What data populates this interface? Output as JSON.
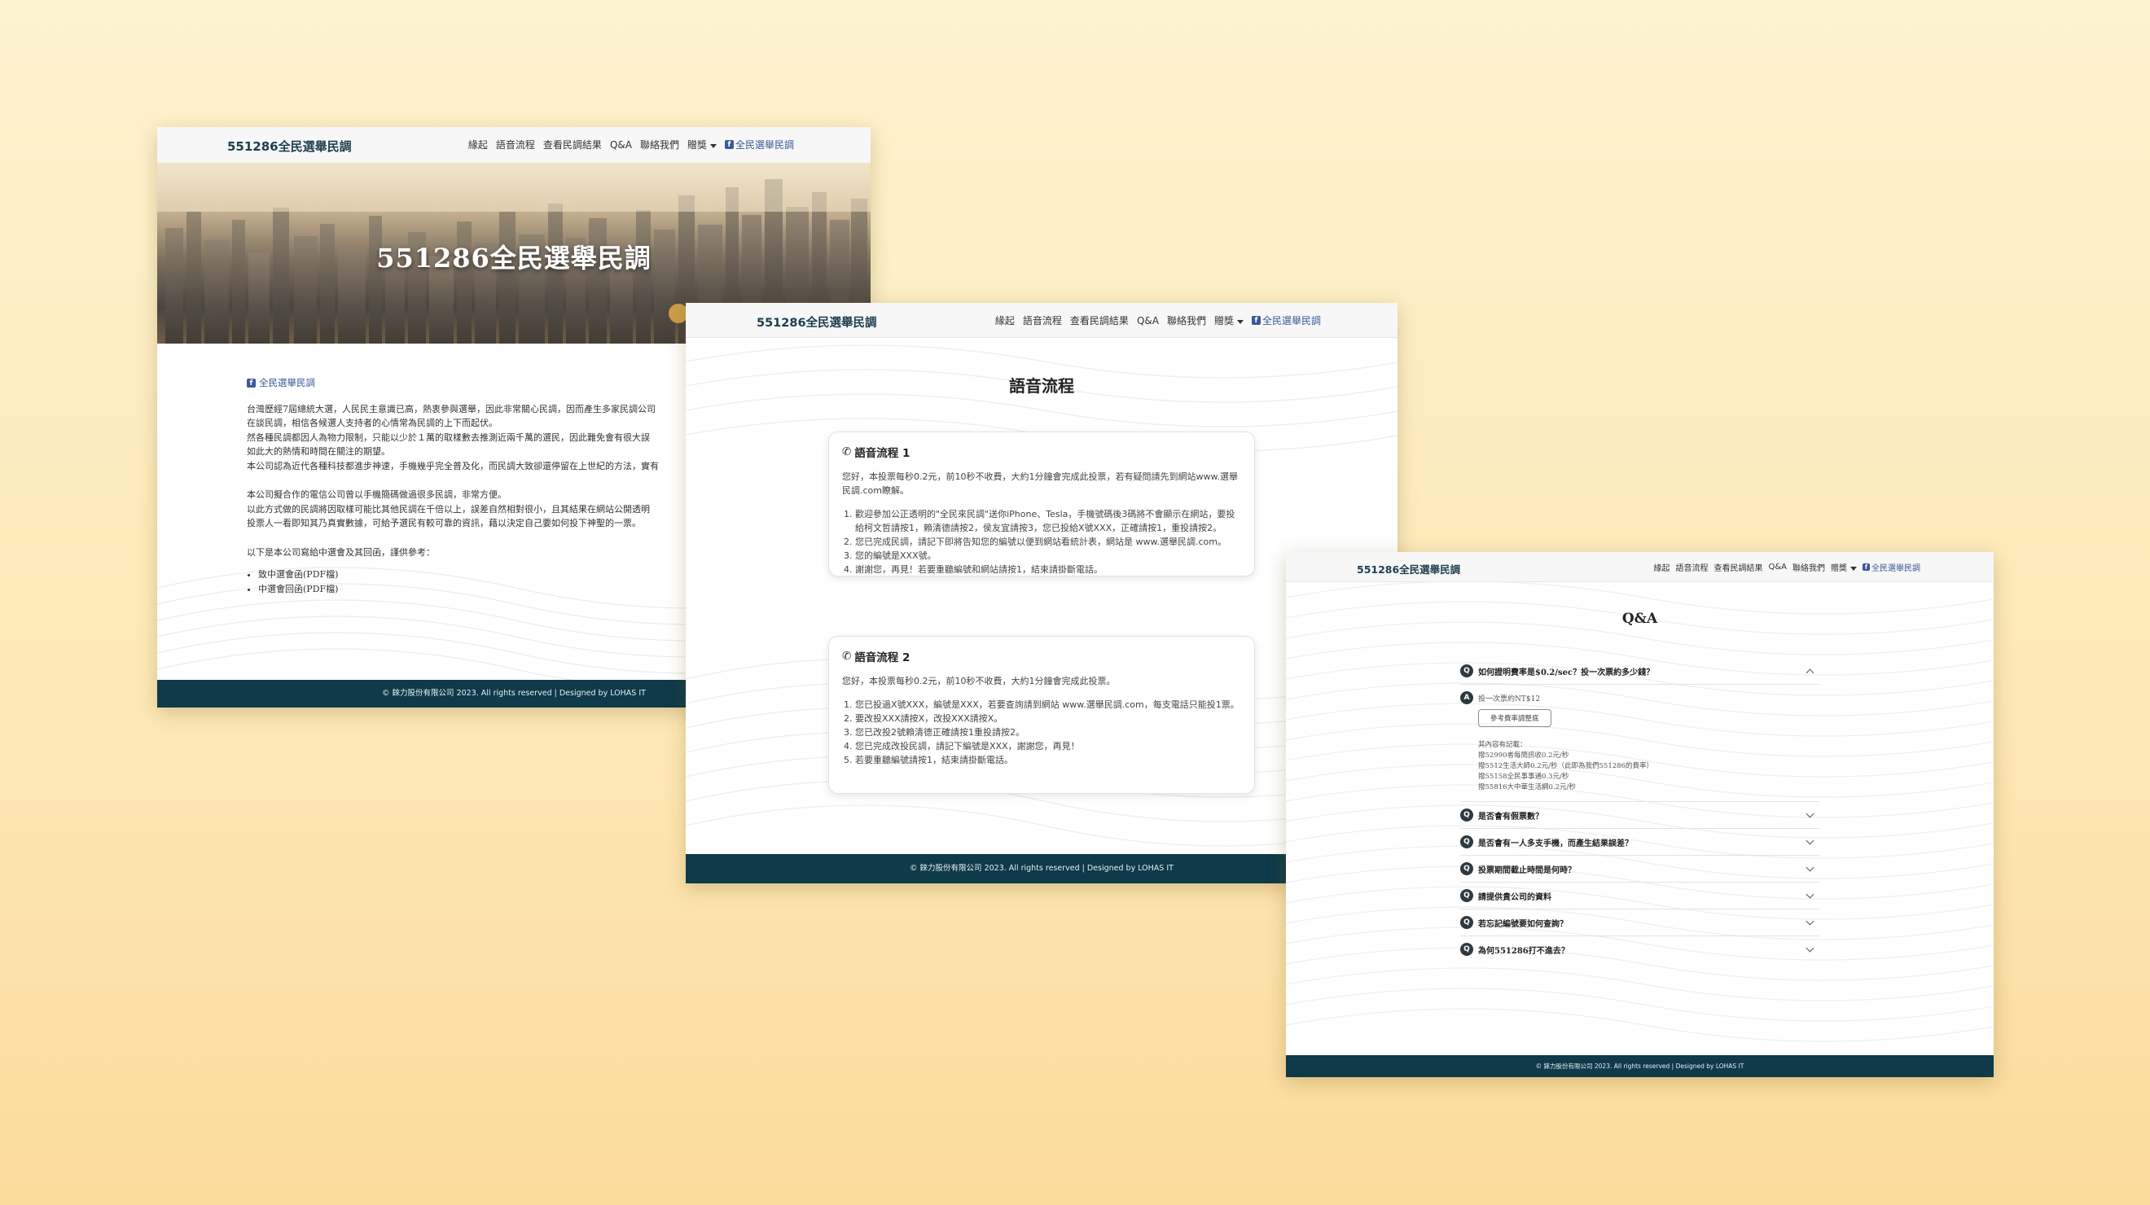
{
  "site": {
    "brand": "551286全民選舉民調",
    "nav": [
      "緣起",
      "語音流程",
      "查看民調結果",
      "Q&A",
      "聯絡我們",
      "贈獎"
    ],
    "fb_link": "全民選舉民調",
    "footer": "© 錸力股份有限公司 2023. All rights reserved | Designed by LOHAS IT"
  },
  "home": {
    "hero_title": "551286全民選舉民調",
    "fb_link": "全民選舉民調",
    "paragraphs": [
      "台灣歷經7屆總統大選，人民民主意識已高，熱衷參與選舉，因此非常關心民調，因而產生多家民調公司",
      "在談民調，相信各候選人支持者的心情常為民調的上下而起伏。",
      "然各種民調都因人為物力限制，只能以少於１萬的取樣數去推測近兩千萬的選民，因此難免會有很大誤",
      "如此大的熱情和時間在關注的期望。",
      "本公司認為近代各種科技都進步神速，手機幾乎完全普及化，而民調大致卻還停留在上世紀的方法，實有"
    ],
    "paragraphs2": [
      "本公司擬合作的電信公司曾以手機簡碼做過很多民調，非常方便。",
      "以此方式做的民調將因取樣可能比其他民調在千倍以上，誤差自然相對很小，且其結果在網站公開透明",
      "投票人一看即知其乃真實數據，可給予選民有較可靠的資訊，藉以決定自己要如何投下神聖的一票。"
    ],
    "docs_intro": "以下是本公司寫給中選會及其回函，謹供參考：",
    "docs": [
      "致中選會函(PDF檔)",
      "中選會回函(PDF檔)"
    ]
  },
  "voice": {
    "title": "語音流程",
    "cards": [
      {
        "heading": "語音流程 1",
        "intro": "您好，本投票每秒0.2元，前10秒不收費，大約1分鐘會完成此投票，若有疑問請先到網站www.選舉民調.com瞭解。",
        "steps": [
          "歡迎參加公正透明的\"全民來民調\"送你iPhone、Tesla，手機號碼後3碼將不會顯示在網站，要投給柯文哲請按1，賴清德請按2，侯友宜請按3，您已投給X號XXX，正確請按1，重投請按2。",
          "您已完成民調，請記下即將告知您的編號以便到網站看統計表，網站是 www.選舉民調.com。",
          "您的編號是XXX號。",
          "謝謝您，再見！若要重聽編號和網站請按1，結束請掛斷電話。"
        ]
      },
      {
        "heading": "語音流程 2",
        "intro": "您好，本投票每秒0.2元，前10秒不收費，大約1分鐘會完成此投票。",
        "steps": [
          "您已投過X號XXX，編號是XXX，若要查詢請到網站 www.選舉民調.com，每支電話只能投1票。",
          "要改投XXX請按X，改投XXX請按X。",
          "您已改投2號賴清德正確請按1重投請按2。",
          "您已完成改投民調，請記下編號是XXX，謝謝您，再見！",
          "若要重聽編號請按1，結束請掛斷電話。"
        ]
      }
    ]
  },
  "qa": {
    "title": "Q&A",
    "expanded": {
      "question": "如何證明費率是$0.2/sec？投一次票約多少錢？",
      "answer": "投一次票約NT$12",
      "button": "參考費率調整底",
      "notes": [
        "其內容有記載：",
        "撥52990者每簡訊收0.2元/秒",
        "撥5512生活大師0.2元/秒（此即為我們551286的費率）",
        "撥55158全民事事通0.3元/秒",
        "撥55816大中華生活網0.2元/秒"
      ]
    },
    "questions": [
      "是否會有假票數？",
      "是否會有一人多支手機，而產生結果誤差？",
      "投票期間截止時間是何時？",
      "請提供貴公司的資料",
      "若忘記編號要如何查詢？",
      "為何551286打不進去？"
    ],
    "badge_q": "Q",
    "badge_a": "A"
  }
}
